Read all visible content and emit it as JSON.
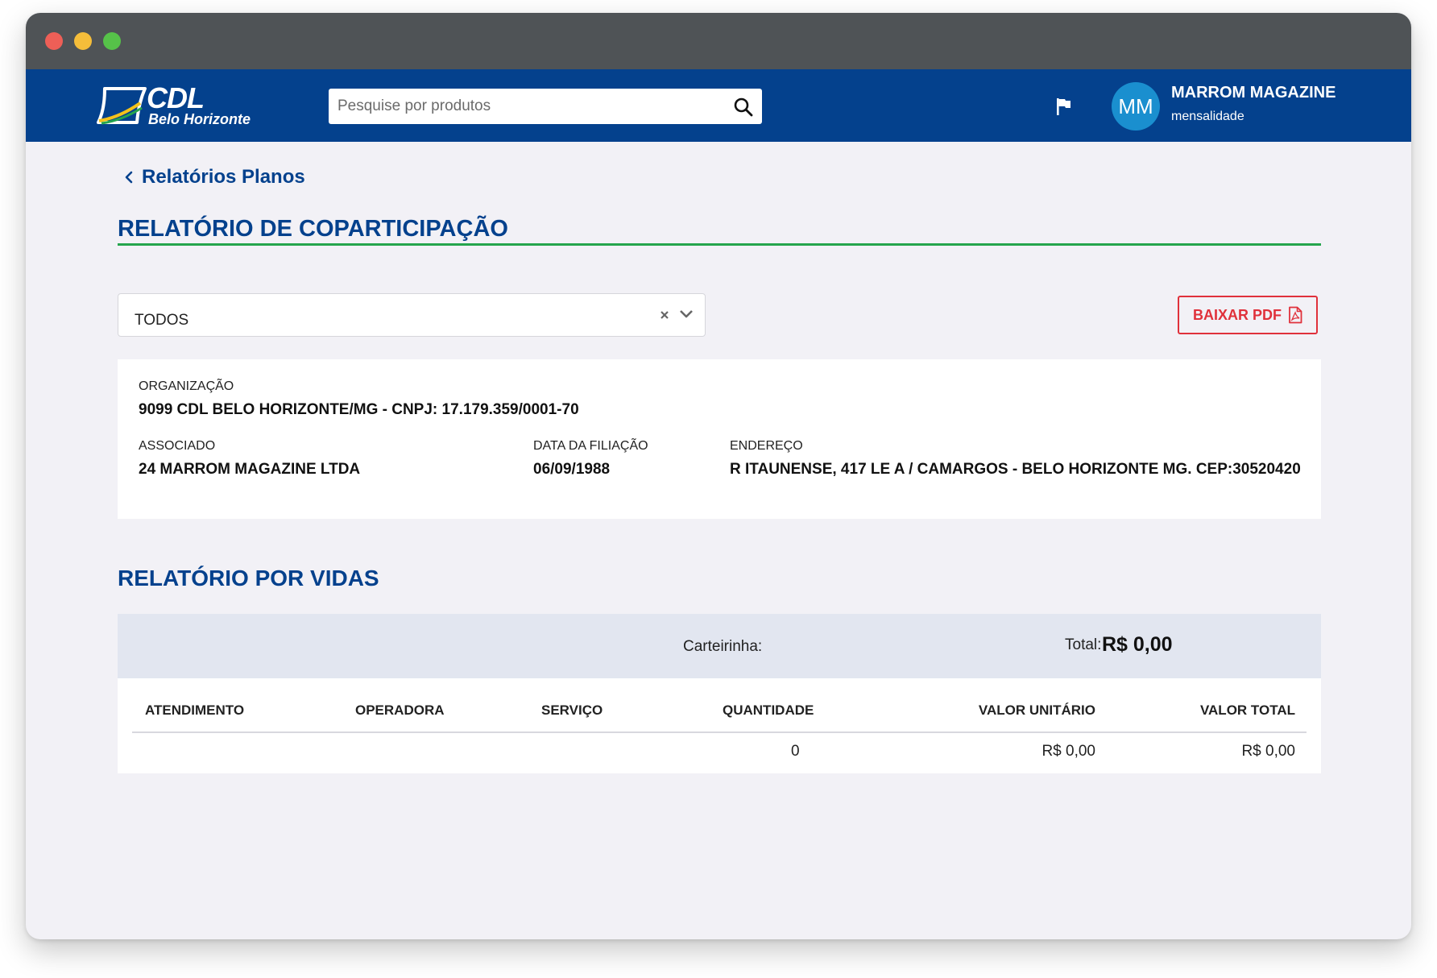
{
  "window": {
    "traffic_lights": [
      "close",
      "minimize",
      "zoom"
    ]
  },
  "header": {
    "logo": {
      "title": "CDL",
      "subtitle": "Belo Horizonte"
    },
    "search": {
      "placeholder": "Pesquise por produtos",
      "value": ""
    },
    "user": {
      "initials": "MM",
      "name": "MARROM MAGAZINE",
      "plan": "mensalidade"
    }
  },
  "breadcrumb": {
    "back_label": "Relatórios Planos"
  },
  "page": {
    "title": "RELATÓRIO DE COPARTICIPAÇÃO",
    "filter": {
      "selected": "TODOS"
    },
    "download_pdf_label": "BAIXAR PDF"
  },
  "info": {
    "organizacao_label": "ORGANIZAÇÃO",
    "organizacao_value": "9099 CDL BELO HORIZONTE/MG - CNPJ: 17.179.359/0001-70",
    "associado_label": "ASSOCIADO",
    "associado_value": "24 MARROM MAGAZINE LTDA",
    "filiacao_label": "DATA DA FILIAÇÃO",
    "filiacao_value": "06/09/1988",
    "endereco_label": "ENDEREÇO",
    "endereco_value": "R ITAUNENSE, 417 LE A / CAMARGOS - BELO HORIZONTE MG. CEP:30520420"
  },
  "vidas": {
    "title": "RELATÓRIO POR VIDAS",
    "carteirinha_label": "Carteirinha:",
    "total_label": "Total:",
    "total_value": "R$ 0,00",
    "columns": [
      "ATENDIMENTO",
      "OPERADORA",
      "SERVIÇO",
      "QUANTIDADE",
      "VALOR UNITÁRIO",
      "VALOR TOTAL"
    ],
    "rows": [
      {
        "atendimento": "",
        "operadora": "",
        "servico": "",
        "quantidade": "0",
        "valor_unitario": "R$ 0,00",
        "valor_total": "R$ 0,00"
      }
    ]
  },
  "colors": {
    "brand_blue": "#04418d",
    "accent_green": "#25a54d",
    "pdf_red": "#e0313b",
    "avatar_blue": "#1a8fcf"
  }
}
